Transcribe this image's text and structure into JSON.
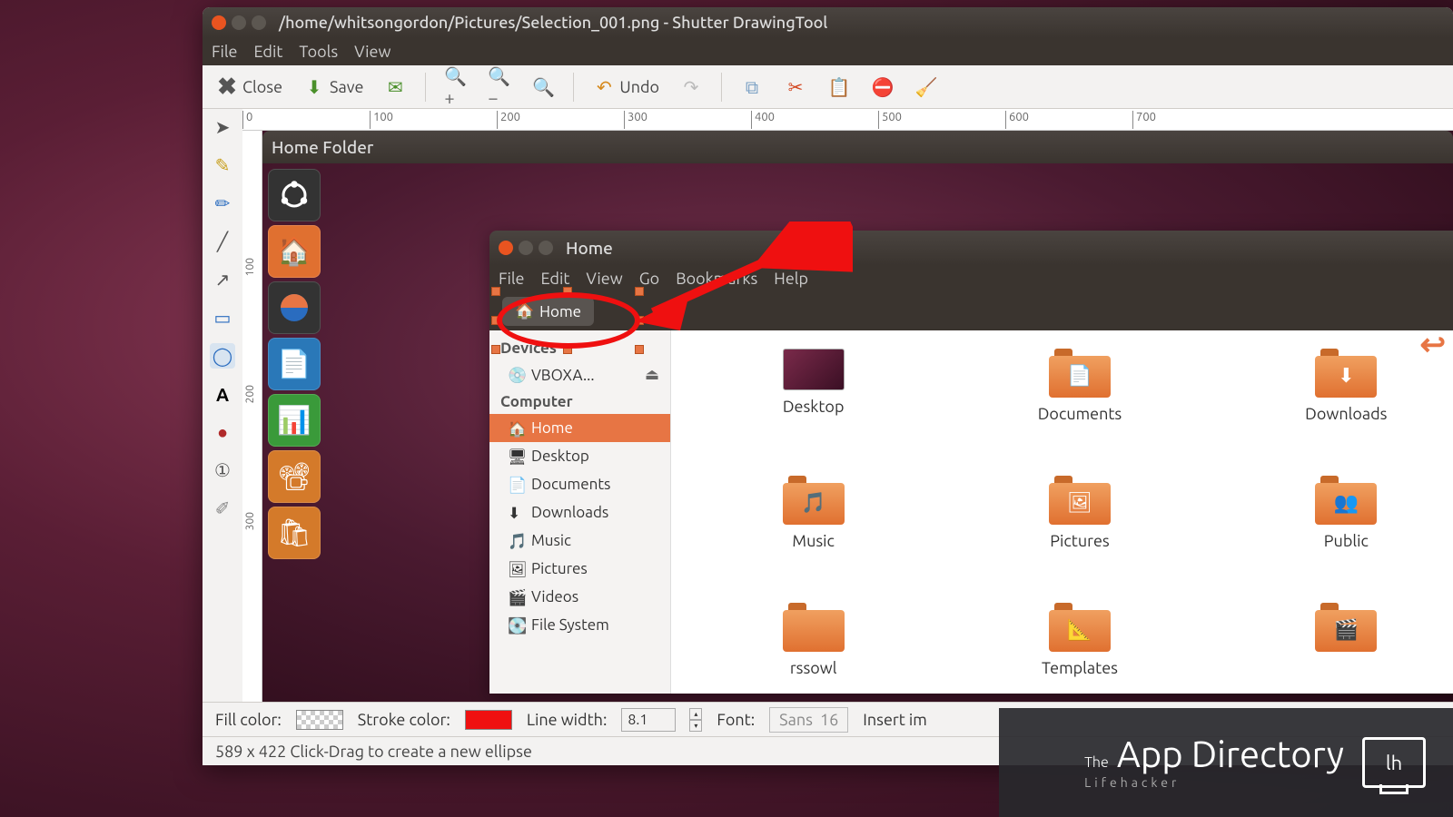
{
  "window": {
    "title": "/home/whitsongordon/Pictures/Selection_001.png - Shutter DrawingTool"
  },
  "menubar": {
    "file": "File",
    "edit": "Edit",
    "tools": "Tools",
    "view": "View"
  },
  "toolbar": {
    "close": "Close",
    "save": "Save",
    "undo": "Undo"
  },
  "ruler": {
    "t0": "0",
    "t100": "100",
    "t200": "200",
    "t300": "300",
    "t400": "400",
    "t500": "500",
    "t600": "600",
    "t700": "700",
    "v100": "100",
    "v200": "200",
    "v300": "300"
  },
  "innerTitle": {
    "homefolder": "Home Folder"
  },
  "nautilus": {
    "title": "Home",
    "menu": {
      "file": "File",
      "edit": "Edit",
      "view": "View",
      "go": "Go",
      "bookmarks": "Bookmarks",
      "help": "Help"
    },
    "loc": {
      "home": "Home"
    },
    "sidebar": {
      "devicesHead": "Devices",
      "vbox": "VBOXA...",
      "computerHead": "Computer",
      "home": "Home",
      "desktop": "Desktop",
      "documents": "Documents",
      "downloads": "Downloads",
      "music": "Music",
      "pictures": "Pictures",
      "videos": "Videos",
      "filesystem": "File System"
    },
    "folders": {
      "desktop": "Desktop",
      "documents": "Documents",
      "downloads": "Downloads",
      "music": "Music",
      "pictures": "Pictures",
      "public": "Public",
      "rssowl": "rssowl",
      "templates": "Templates"
    }
  },
  "propbar": {
    "fill": "Fill color:",
    "stroke": "Stroke color:",
    "linew": "Line width:",
    "linewval": "8.1",
    "font": "Font:",
    "fontname": "Sans",
    "fontsize": "16",
    "insert": "Insert im"
  },
  "status": {
    "text": "589 x 422 Click-Drag to create a new ellipse"
  },
  "watermark": {
    "the": "The",
    "main": "App Directory",
    "sub": "Lifehacker",
    "logo": "lh"
  }
}
